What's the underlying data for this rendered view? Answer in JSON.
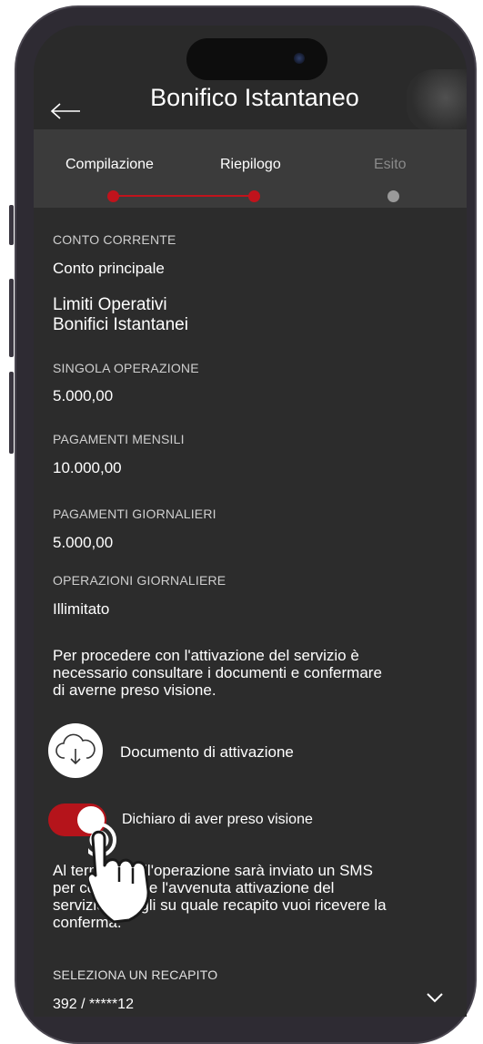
{
  "header": {
    "title": "Bonifico Istantaneo",
    "back_icon": "arrow-left-icon"
  },
  "steps": [
    {
      "label": "Compilazione",
      "active": true
    },
    {
      "label": "Riepilogo",
      "active": true
    },
    {
      "label": "Esito",
      "active": false
    }
  ],
  "colors": {
    "accent": "#c0131c",
    "background": "#2c2c2c",
    "steps_bar": "#3b3b3b"
  },
  "account": {
    "label": "CONTO CORRENTE",
    "value": "Conto principale"
  },
  "limits": {
    "title_line1": "Limiti Operativi",
    "title_line2": "Bonifici Istantanei",
    "items": [
      {
        "label": "SINGOLA OPERAZIONE",
        "value": "5.000,00"
      },
      {
        "label": "PAGAMENTI MENSILI",
        "value": "10.000,00"
      },
      {
        "label": "PAGAMENTI GIORNALIERI",
        "value": "5.000,00"
      },
      {
        "label": "OPERAZIONI GIORNALIERE",
        "value": "Illimitato"
      }
    ]
  },
  "notice": {
    "line1": "Per procedere con l'attivazione del servizio è",
    "line2": "necessario consultare i documenti e confermare",
    "line3": "di averne preso visione."
  },
  "document": {
    "label": "Documento di attivazione",
    "icon": "cloud-download-icon"
  },
  "consent": {
    "label": "Dichiaro di aver preso visione",
    "checked": true
  },
  "sms_notice": {
    "line1": "Al termine dell'operazione sarà inviato un SMS",
    "line2": "per confermare l'avvenuta attivazione del",
    "line3": "servizio. Scegli su quale recapito vuoi ricevere la",
    "line4": "conferma."
  },
  "contact": {
    "label": "SELEZIONA UN RECAPITO",
    "value": "392 / *****12",
    "icon": "chevron-down-icon"
  }
}
